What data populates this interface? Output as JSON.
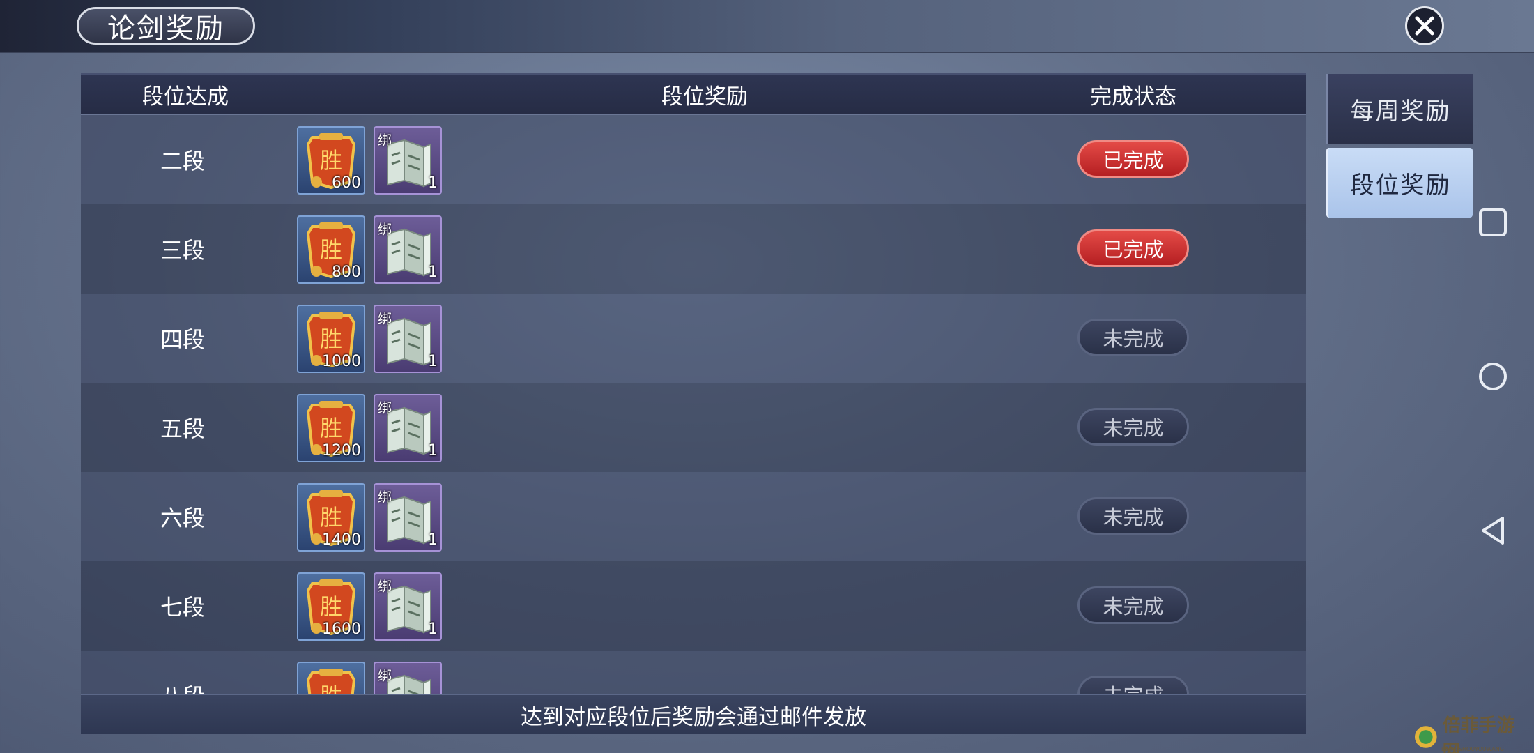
{
  "header": {
    "title": "论剑奖励",
    "close_icon": "close-icon"
  },
  "table": {
    "columns": [
      "段位达成",
      "段位奖励",
      "完成状态"
    ],
    "rows": [
      {
        "rank": "二段",
        "token_qty": "600",
        "bind_label": "绑",
        "scroll_qty": "1",
        "status": "已完成",
        "done": true
      },
      {
        "rank": "三段",
        "token_qty": "800",
        "bind_label": "绑",
        "scroll_qty": "1",
        "status": "已完成",
        "done": true
      },
      {
        "rank": "四段",
        "token_qty": "1000",
        "bind_label": "绑",
        "scroll_qty": "1",
        "status": "未完成",
        "done": false
      },
      {
        "rank": "五段",
        "token_qty": "1200",
        "bind_label": "绑",
        "scroll_qty": "1",
        "status": "未完成",
        "done": false
      },
      {
        "rank": "六段",
        "token_qty": "1400",
        "bind_label": "绑",
        "scroll_qty": "1",
        "status": "未完成",
        "done": false
      },
      {
        "rank": "七段",
        "token_qty": "1600",
        "bind_label": "绑",
        "scroll_qty": "1",
        "status": "未完成",
        "done": false
      },
      {
        "rank": "八段",
        "token_qty": "",
        "bind_label": "绑",
        "scroll_qty": "",
        "status": "未完成",
        "done": false
      }
    ],
    "token_glyph": "胜"
  },
  "footer": {
    "note": "达到对应段位后奖励会通过邮件发放"
  },
  "tabs": [
    {
      "label": "每周奖励",
      "active": false
    },
    {
      "label": "段位奖励",
      "active": true
    }
  ],
  "watermark": {
    "text": "倍菲手游网",
    "sub": "BEIFEISHOUYOUWANG"
  },
  "colors": {
    "done": "#c8272a",
    "todo": "#2f3650",
    "active_tab": "#b8cff0"
  }
}
